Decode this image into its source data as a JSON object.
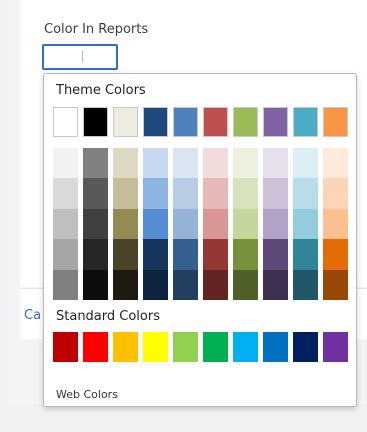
{
  "field": {
    "label": "Color In Reports",
    "value": ""
  },
  "background": {
    "cancel_label": "Ca"
  },
  "picker": {
    "theme_title": "Theme Colors",
    "standard_title": "Standard Colors",
    "web_colors_label": "Web Colors",
    "theme_colors": [
      "#ffffff",
      "#000000",
      "#eeece1",
      "#1f497d",
      "#4f81bd",
      "#c0504d",
      "#9bbb59",
      "#8064a2",
      "#4bacc6",
      "#f79646"
    ],
    "theme_shades": [
      [
        "#f2f2f2",
        "#d9d9d9",
        "#bfbfbf",
        "#a6a6a6",
        "#808080"
      ],
      [
        "#808080",
        "#595959",
        "#404040",
        "#262626",
        "#0d0d0d"
      ],
      [
        "#ddd9c3",
        "#c4bd97",
        "#948a54",
        "#4a452a",
        "#1d1b10"
      ],
      [
        "#c6d9f0",
        "#8db3e2",
        "#548dd4",
        "#17365d",
        "#0f243e"
      ],
      [
        "#dbe5f1",
        "#b8cce4",
        "#95b3d7",
        "#366092",
        "#244061"
      ],
      [
        "#f2dcdb",
        "#e6b9b8",
        "#d99694",
        "#953734",
        "#632523"
      ],
      [
        "#ebf1dd",
        "#d7e3bc",
        "#c3d69b",
        "#76923c",
        "#4f6128"
      ],
      [
        "#e5e0ec",
        "#ccc1d9",
        "#b2a2c7",
        "#5f497a",
        "#3f3151"
      ],
      [
        "#dbeef3",
        "#b7dde8",
        "#92cddc",
        "#31859b",
        "#205867"
      ],
      [
        "#fdeada",
        "#fbd5b5",
        "#fac08f",
        "#e36c09",
        "#974806"
      ]
    ],
    "standard_colors": [
      "#c00000",
      "#ff0000",
      "#ffc000",
      "#ffff00",
      "#92d050",
      "#00b050",
      "#00b0f0",
      "#0070c0",
      "#002060",
      "#7030a0"
    ]
  }
}
